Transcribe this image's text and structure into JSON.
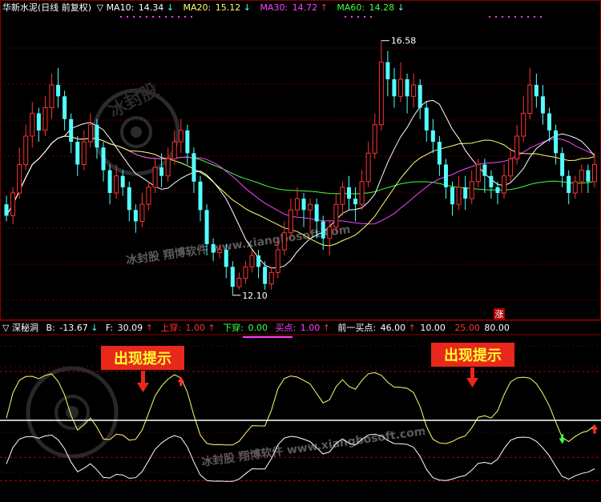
{
  "header": {
    "stock": "华新水泥(日线 前复权)",
    "triangle": "▽",
    "ma10_label": "MA10:",
    "ma10_value": "14.34",
    "ma20_label": "MA20:",
    "ma20_value": "15.12",
    "ma30_label": "MA30:",
    "ma30_value": "14.72",
    "ma60_label": "MA60:",
    "ma60_value": "14.28",
    "arrow_up": "↑",
    "arrow_down": "↓"
  },
  "indicator_header": {
    "triangle": "▽",
    "name": "深秘洞",
    "b_label": "B:",
    "b_value": "-13.67",
    "f_label": "F:",
    "f_value": "30.09",
    "up_cross_label": "上穿:",
    "up_cross_value": "1.00",
    "down_cross_label": "下穿:",
    "down_cross_value": "0.00",
    "buy_label": "买点:",
    "buy_value": "1.00",
    "prev_buy_label": "前一买点:",
    "prev_buy_value": "46.00",
    "level1": "10.00",
    "level2": "25.00",
    "level3": "80.00"
  },
  "annotations": {
    "high": "16.58",
    "low": "12.10",
    "zhang": "涨",
    "tip1": "出现提示",
    "tip2": "出现提示"
  },
  "watermarks": {
    "text1": "冰封股  翔博软件  www.xiangbosoft.com",
    "text2": "冰封股  翔博软件  www.xiangbosoft.com",
    "seal": "冰封股"
  },
  "colors": {
    "up": "#ff3232",
    "down": "#54ffff",
    "ma10": "#ffffff",
    "ma20": "#ffff70",
    "ma30": "#ff40ff",
    "ma60": "#40ff40",
    "tip_bg": "#e8281a",
    "tip_text": "#ffff30"
  },
  "chart_data": {
    "type": "candlestick",
    "price_range": [
      12.1,
      16.58
    ],
    "candles": [
      [
        13.7,
        13.5,
        13.85,
        13.4
      ],
      [
        13.5,
        13.9,
        14.0,
        13.35
      ],
      [
        13.9,
        14.4,
        14.7,
        13.8
      ],
      [
        14.4,
        14.9,
        15.1,
        14.3
      ],
      [
        14.9,
        15.3,
        15.5,
        14.7
      ],
      [
        15.3,
        15.0,
        15.4,
        14.8
      ],
      [
        15.0,
        15.4,
        15.6,
        14.9
      ],
      [
        15.4,
        15.8,
        16.0,
        15.2
      ],
      [
        15.8,
        15.6,
        16.1,
        15.4
      ],
      [
        15.6,
        15.2,
        15.7,
        15.0
      ],
      [
        15.2,
        14.8,
        15.3,
        14.6
      ],
      [
        14.8,
        14.4,
        14.9,
        14.2
      ],
      [
        14.4,
        14.8,
        15.0,
        14.3
      ],
      [
        14.8,
        15.1,
        15.3,
        14.7
      ],
      [
        15.1,
        14.7,
        15.2,
        14.5
      ],
      [
        14.7,
        14.3,
        14.8,
        14.1
      ],
      [
        14.3,
        13.9,
        14.4,
        13.7
      ],
      [
        13.9,
        14.2,
        14.4,
        13.8
      ],
      [
        14.2,
        14.0,
        14.3,
        13.85
      ],
      [
        14.0,
        13.6,
        14.1,
        13.4
      ],
      [
        13.6,
        13.4,
        13.7,
        13.2
      ],
      [
        13.4,
        13.7,
        13.9,
        13.3
      ],
      [
        13.7,
        14.0,
        14.1,
        13.6
      ],
      [
        14.0,
        14.35,
        14.5,
        13.9
      ],
      [
        14.35,
        14.2,
        14.6,
        14.0
      ],
      [
        14.2,
        14.5,
        14.7,
        14.1
      ],
      [
        14.5,
        14.8,
        15.0,
        14.4
      ],
      [
        14.8,
        15.0,
        15.2,
        14.6
      ],
      [
        15.0,
        14.6,
        15.1,
        14.4
      ],
      [
        14.6,
        14.1,
        14.7,
        13.9
      ],
      [
        14.1,
        13.6,
        14.2,
        13.4
      ],
      [
        13.6,
        13.0,
        13.7,
        12.8
      ],
      [
        13.0,
        12.85,
        13.1,
        12.7
      ],
      [
        12.85,
        12.9,
        13.0,
        12.75
      ],
      [
        12.9,
        12.6,
        13.0,
        12.4
      ],
      [
        12.6,
        12.25,
        12.7,
        12.1
      ],
      [
        12.25,
        12.4,
        12.5,
        12.2
      ],
      [
        12.4,
        12.6,
        12.7,
        12.3
      ],
      [
        12.6,
        12.8,
        12.9,
        12.5
      ],
      [
        12.8,
        12.6,
        12.9,
        12.4
      ],
      [
        12.6,
        12.3,
        12.7,
        12.2
      ],
      [
        12.3,
        12.5,
        12.6,
        12.2
      ],
      [
        12.5,
        12.9,
        13.1,
        12.4
      ],
      [
        12.9,
        13.2,
        13.4,
        12.8
      ],
      [
        13.2,
        13.6,
        13.8,
        13.1
      ],
      [
        13.6,
        13.8,
        14.0,
        13.5
      ],
      [
        13.8,
        13.6,
        13.9,
        13.3
      ],
      [
        13.6,
        13.7,
        13.8,
        13.2
      ],
      [
        13.7,
        13.4,
        13.8,
        13.1
      ],
      [
        13.4,
        13.1,
        13.5,
        12.9
      ],
      [
        13.1,
        13.3,
        13.4,
        12.8
      ],
      [
        13.3,
        13.7,
        13.9,
        13.2
      ],
      [
        13.7,
        14.0,
        14.1,
        13.5
      ],
      [
        14.0,
        13.8,
        14.2,
        13.6
      ],
      [
        13.8,
        13.7,
        14.0,
        13.4
      ],
      [
        13.7,
        14.1,
        14.3,
        13.6
      ],
      [
        14.1,
        14.6,
        14.8,
        14.0
      ],
      [
        14.6,
        15.1,
        15.3,
        14.5
      ],
      [
        15.1,
        16.2,
        16.58,
        15.0
      ],
      [
        16.2,
        15.9,
        16.4,
        15.6
      ],
      [
        15.9,
        15.6,
        16.1,
        15.4
      ],
      [
        15.6,
        15.9,
        16.2,
        15.5
      ],
      [
        15.9,
        15.6,
        16.0,
        15.3
      ],
      [
        15.6,
        15.8,
        16.0,
        15.4
      ],
      [
        15.8,
        15.4,
        15.9,
        15.2
      ],
      [
        15.4,
        15.0,
        15.5,
        14.8
      ],
      [
        15.0,
        14.8,
        15.2,
        14.6
      ],
      [
        14.8,
        14.4,
        14.9,
        14.2
      ],
      [
        14.4,
        14.0,
        14.5,
        13.8
      ],
      [
        14.0,
        13.7,
        14.1,
        13.5
      ],
      [
        13.7,
        14.0,
        14.2,
        13.6
      ],
      [
        14.0,
        13.8,
        14.2,
        13.6
      ],
      [
        13.8,
        14.1,
        14.3,
        13.7
      ],
      [
        14.1,
        14.4,
        14.5,
        14.0
      ],
      [
        14.4,
        14.2,
        14.5,
        13.9
      ],
      [
        14.2,
        14.0,
        14.3,
        13.8
      ],
      [
        14.0,
        13.9,
        14.1,
        13.7
      ],
      [
        13.9,
        14.2,
        14.4,
        13.8
      ],
      [
        14.2,
        14.5,
        14.7,
        14.1
      ],
      [
        14.5,
        14.9,
        15.1,
        14.4
      ],
      [
        14.9,
        15.3,
        15.6,
        14.8
      ],
      [
        15.3,
        15.8,
        16.1,
        15.2
      ],
      [
        15.8,
        15.6,
        16.0,
        15.4
      ],
      [
        15.6,
        15.3,
        15.8,
        15.1
      ],
      [
        15.3,
        15.0,
        15.4,
        14.8
      ],
      [
        15.0,
        14.6,
        15.1,
        14.4
      ],
      [
        14.6,
        14.2,
        14.7,
        14.0
      ],
      [
        14.2,
        13.9,
        14.3,
        13.7
      ],
      [
        13.9,
        14.1,
        14.2,
        13.8
      ],
      [
        14.1,
        14.3,
        14.4,
        13.9
      ],
      [
        14.3,
        14.1,
        14.4,
        13.9
      ],
      [
        14.1,
        14.4,
        14.6,
        14.0
      ]
    ],
    "series_note_free": true,
    "indicator": {
      "range": [
        0,
        100
      ],
      "levels": [
        10,
        25,
        80
      ],
      "signal_up_indices": [
        27,
        91
      ],
      "signal_down_indices": [
        86
      ]
    }
  }
}
